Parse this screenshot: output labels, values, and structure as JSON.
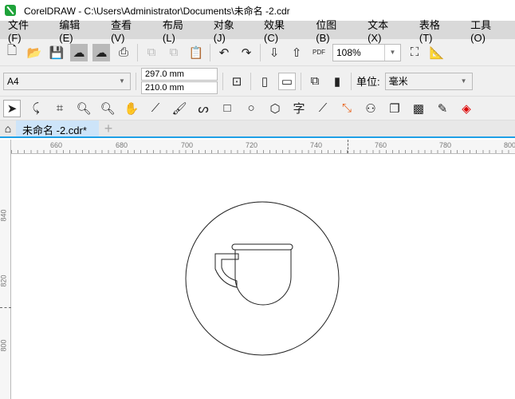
{
  "window": {
    "title": "CorelDRAW - C:\\Users\\Administrator\\Documents\\未命名 -2.cdr"
  },
  "menu": [
    "文件(F)",
    "编辑(E)",
    "查看(V)",
    "布局(L)",
    "对象(J)",
    "效果(C)",
    "位图(B)",
    "文本(X)",
    "表格(T)",
    "工具(O)"
  ],
  "toolbar": {
    "zoom": "108%",
    "pdf": "PDF"
  },
  "property_bar": {
    "page_size": "A4",
    "height": "297.0 mm",
    "width": "210.0 mm",
    "unit_label": "单位:",
    "unit": "毫米"
  },
  "tools": {
    "text_tool": "字"
  },
  "tabs": {
    "doc": "未命名 -2.cdr*"
  },
  "ruler": {
    "h": [
      "660",
      "680",
      "700",
      "720",
      "740",
      "760",
      "780",
      "800"
    ],
    "v": [
      "840",
      "820",
      "800"
    ]
  }
}
